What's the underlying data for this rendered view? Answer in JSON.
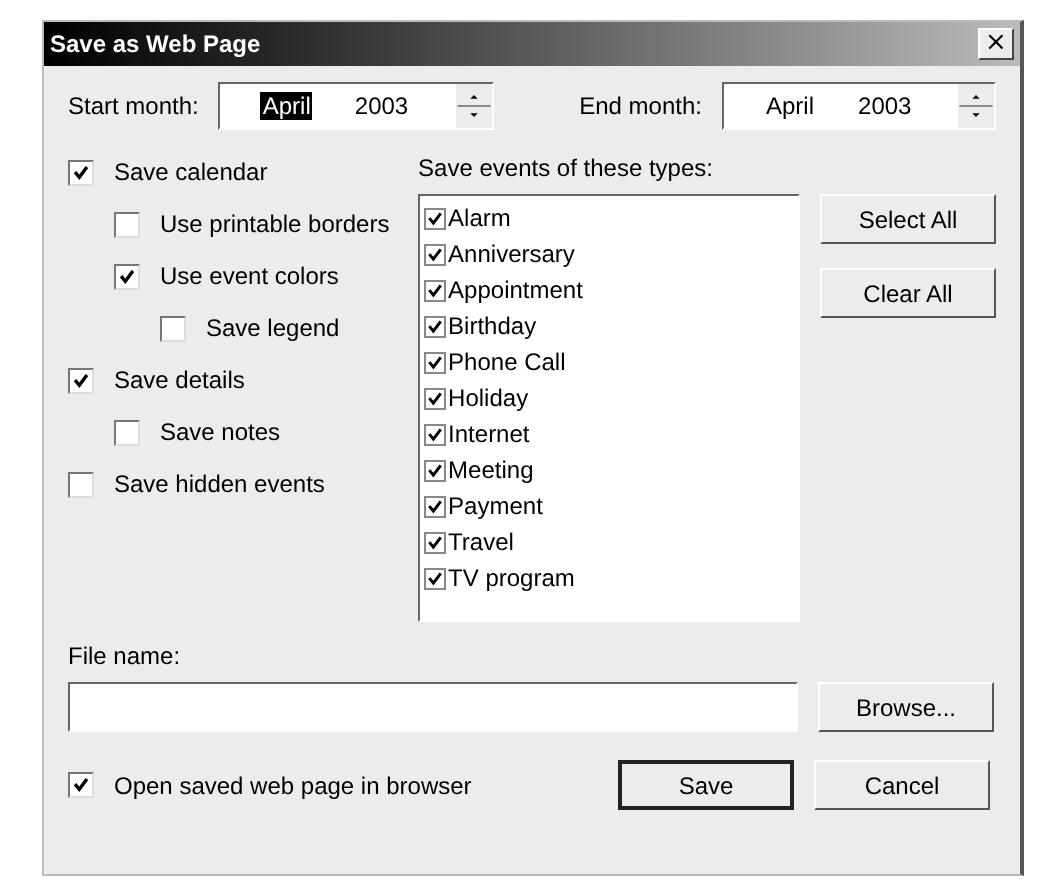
{
  "window": {
    "title": "Save as Web Page",
    "close": "×"
  },
  "months": [
    {
      "label": "Start month:",
      "month": "April",
      "year": "2003",
      "focused": true
    },
    {
      "label": "End month:",
      "month": "April",
      "year": "2003",
      "focused": false
    }
  ],
  "options": [
    {
      "label": "Save calendar",
      "checked": true,
      "children": [
        {
          "label": "Use printable borders",
          "checked": false
        },
        {
          "label": "Use event colors",
          "checked": true,
          "children": [
            {
              "label": "Save legend",
              "checked": false
            }
          ]
        }
      ]
    },
    {
      "label": "Save details",
      "checked": true,
      "children": [
        {
          "label": "Save notes",
          "checked": false
        }
      ]
    },
    {
      "label": "Save hidden events",
      "checked": false
    }
  ],
  "event_types": {
    "label": "Save events of these types:",
    "items": [
      {
        "label": "Alarm",
        "checked": true
      },
      {
        "label": "Anniversary",
        "checked": true
      },
      {
        "label": "Appointment",
        "checked": true
      },
      {
        "label": "Birthday",
        "checked": true
      },
      {
        "label": "Phone Call",
        "checked": true
      },
      {
        "label": "Holiday",
        "checked": true
      },
      {
        "label": "Internet",
        "checked": true
      },
      {
        "label": "Meeting",
        "checked": true
      },
      {
        "label": "Payment",
        "checked": true
      },
      {
        "label": "Travel",
        "checked": true
      },
      {
        "label": "TV program",
        "checked": true
      }
    ]
  },
  "list_buttons": [
    "Select All",
    "Clear All"
  ],
  "file": {
    "label": "File name:",
    "browse": "Browse..."
  },
  "open_in_browser": {
    "label": "Open saved web page in browser",
    "checked": true
  },
  "buttons": [
    {
      "label": "Save",
      "default": true
    },
    {
      "label": "Cancel",
      "default": false
    }
  ]
}
